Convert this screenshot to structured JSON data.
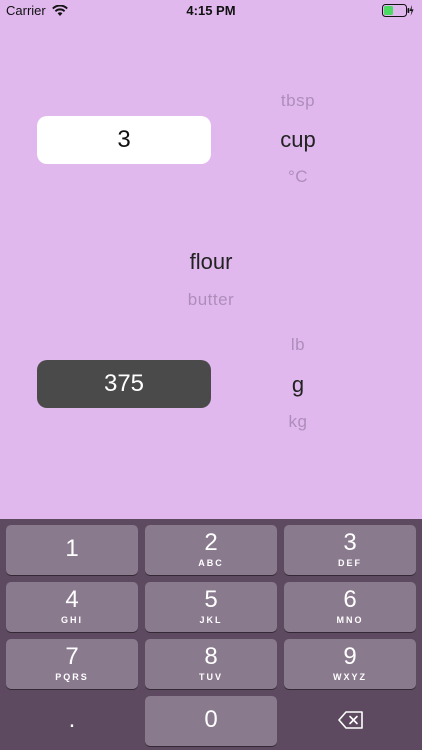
{
  "status_bar": {
    "carrier": "Carrier",
    "time": "4:15 PM",
    "battery_color": "#4cd964"
  },
  "input": {
    "value": "3"
  },
  "unit_from": {
    "above": "tbsp",
    "selected": "cup",
    "below": "°C"
  },
  "ingredient": {
    "selected": "flour",
    "below": "butter"
  },
  "result": {
    "value": "375"
  },
  "unit_to": {
    "above": "lb",
    "selected": "g",
    "below": "kg"
  },
  "keypad": {
    "k1": {
      "digit": "1",
      "letters": ""
    },
    "k2": {
      "digit": "2",
      "letters": "ABC"
    },
    "k3": {
      "digit": "3",
      "letters": "DEF"
    },
    "k4": {
      "digit": "4",
      "letters": "GHI"
    },
    "k5": {
      "digit": "5",
      "letters": "JKL"
    },
    "k6": {
      "digit": "6",
      "letters": "MNO"
    },
    "k7": {
      "digit": "7",
      "letters": "PQRS"
    },
    "k8": {
      "digit": "8",
      "letters": "TUV"
    },
    "k9": {
      "digit": "9",
      "letters": "WXYZ"
    },
    "dot": ".",
    "k0": {
      "digit": "0"
    },
    "delete_icon": "delete-backspace-icon"
  },
  "colors": {
    "background": "#e0b8ee",
    "keypad_bg": "#5e4a60",
    "key_bg": "#8a7a8e",
    "result_bg": "#4a4a4a"
  }
}
